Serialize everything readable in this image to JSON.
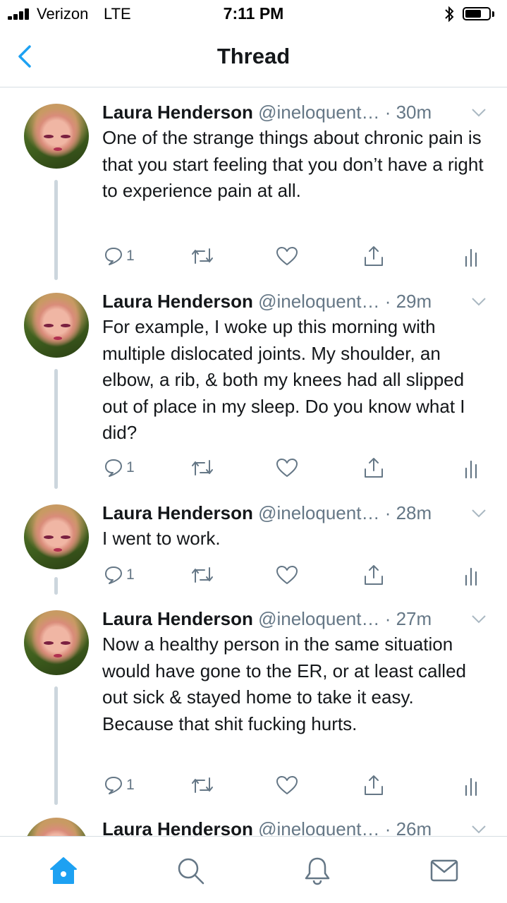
{
  "status_bar": {
    "carrier": "Verizon",
    "network": "LTE",
    "time": "7:11 PM",
    "battery_icon": "battery-icon",
    "bluetooth_icon": "bluetooth-icon"
  },
  "nav": {
    "title": "Thread",
    "back_icon": "chevron-left-icon"
  },
  "tweets": [
    {
      "name": "Laura Henderson",
      "handle": "@ineloquent…",
      "time": "· 30m",
      "text": "One of the strange things about chronic pain is that you start feeling that you don’t have a right to experience pain at all.",
      "replies": "1"
    },
    {
      "name": "Laura Henderson",
      "handle": "@ineloquent…",
      "time": "· 29m",
      "text": "For example, I woke up this morning with multiple dislocated joints. My shoulder, an elbow, a rib, & both my knees had all slipped out of place in my sleep. Do you know what I did?",
      "replies": "1"
    },
    {
      "name": "Laura Henderson",
      "handle": "@ineloquent…",
      "time": "· 28m",
      "text": "I went to work.",
      "replies": "1"
    },
    {
      "name": "Laura Henderson",
      "handle": "@ineloquent…",
      "time": "· 27m",
      "text": "Now a healthy person in the same situation would have gone to the ER, or at least called out sick & stayed home to take it easy. Because that shit fucking hurts.",
      "replies": "1"
    },
    {
      "name": "Laura Henderson",
      "handle": "@ineloquent…",
      "time": "· 26m",
      "text": "",
      "replies": ""
    }
  ],
  "tabs": [
    {
      "name": "home",
      "icon": "home-icon",
      "active": true
    },
    {
      "name": "search",
      "icon": "search-icon",
      "active": false
    },
    {
      "name": "notifications",
      "icon": "bell-icon",
      "active": false
    },
    {
      "name": "messages",
      "icon": "mail-icon",
      "active": false
    }
  ],
  "colors": {
    "accent": "#1da1f2",
    "text": "#14171a",
    "muted": "#657786",
    "divider": "#d6dde3",
    "thread_line": "#ccd6dd"
  }
}
